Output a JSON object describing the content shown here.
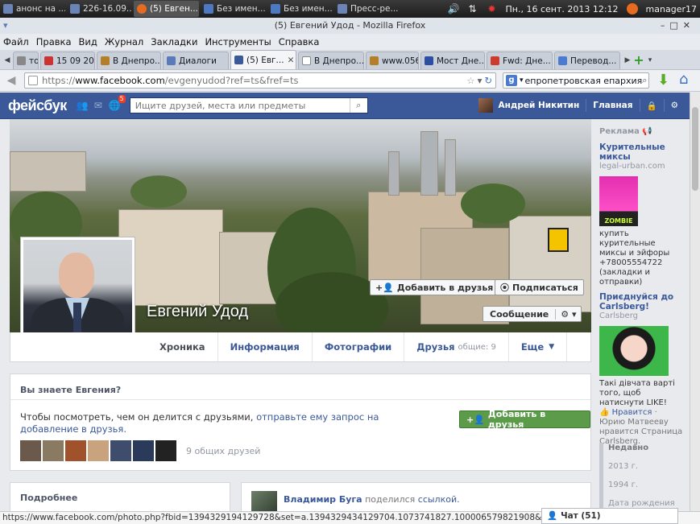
{
  "taskbar": {
    "tasks": [
      {
        "label": "анонс на ...",
        "color": "#6b84b8"
      },
      {
        "label": "226-16.09...",
        "color": "#6b84b8"
      },
      {
        "label": "(5) Евген...",
        "color": "#e66a1f"
      },
      {
        "label": "Без имен...",
        "color": "#4d78c2"
      },
      {
        "label": "Без имен...",
        "color": "#4d78c2"
      },
      {
        "label": "Пресс-ре...",
        "color": "#6b84b8"
      }
    ],
    "datetime": "Пн., 16 сент. 2013 12:12",
    "user": "manager17"
  },
  "window": {
    "title": "(5) Евгений Удод - Mozilla Firefox"
  },
  "menu": [
    "Файл",
    "Правка",
    "Вид",
    "Журнал",
    "Закладки",
    "Инструменты",
    "Справка"
  ],
  "tabs": [
    {
      "label": "то...",
      "color": "#888"
    },
    {
      "label": "15 09 201...",
      "color": "#c33"
    },
    {
      "label": "В Днепро...",
      "color": "#b57f2a"
    },
    {
      "label": "Диалоги",
      "color": "#5a7ab9"
    },
    {
      "label": "(5) Евг...",
      "color": "#3b5998",
      "active": true
    },
    {
      "label": "В Днепро...",
      "color": "#fff"
    },
    {
      "label": "www.056....",
      "color": "#b57f2a"
    },
    {
      "label": "Мост Дне...",
      "color": "#2c4ea3"
    },
    {
      "label": "Fwd: Дне...",
      "color": "#cc3b2e"
    },
    {
      "label": "Перевод...",
      "color": "#4a7bd0"
    }
  ],
  "address": {
    "scheme": "https://",
    "host": "www.facebook.com",
    "path": "/evgenyudod?ref=ts&fref=ts"
  },
  "search": {
    "value": "епропетровская епархия"
  },
  "fb": {
    "logo": "фейсбук",
    "notif_count": "5",
    "search_placeholder": "Ищите друзей, места или предметы",
    "user_name": "Андрей Никитин",
    "home": "Главная"
  },
  "profile": {
    "name": "Евгений Удод",
    "add_friend": "Добавить в друзья",
    "subscribe": "Подписаться",
    "message": "Сообщение",
    "tabs": {
      "timeline": "Хроника",
      "about": "Информация",
      "photos": "Фотографии",
      "friends": "Друзья",
      "friends_sub": "общие: 9",
      "more": "Еще"
    }
  },
  "know": {
    "title": "Вы знаете Евгения?",
    "text": "Чтобы посмотреть, чем он делится с друзьями,",
    "link": "отправьте ему запрос на добавление в друзья.",
    "button": "Добавить в друзья",
    "mutual": "9 общих друзей",
    "friend_colors": [
      "#6b5a4c",
      "#8a7a62",
      "#a0522d",
      "#c9a27e",
      "#3d4d6b",
      "#2a3a5a",
      "#222"
    ]
  },
  "more_panel": {
    "title": "Подробнее"
  },
  "post": {
    "author": "Владимир Буга",
    "verb": "поделился",
    "link": "ссылкой."
  },
  "ads": {
    "header": "Реклама",
    "ad1": {
      "title": "Курительные миксы",
      "domain": "legal-urban.com",
      "img_label": "ZOMBIE",
      "text": "купить курительные миксы и эйфоры +78005554722 (закладки и отправки)"
    },
    "ad2": {
      "title": "Приєднуйся до Carlsberg!",
      "sub": "Carlsberg",
      "text": "Такі дівчата варті того, щоб натиснути LIKE!",
      "like": "Нравится",
      "like_rest": "· Юрию Матвееву нравится Страница Carlsberg."
    }
  },
  "timeline_years": {
    "head": "Недавно",
    "items": [
      "2013 г.",
      "1994 г.",
      "Дата рождения"
    ]
  },
  "status": {
    "url": "https://www.facebook.com/photo.php?fbid=1394329194129728&set=a.1394329434129704.1073741827.100006579821908&type=1"
  },
  "chat": {
    "label": "Чат (51)"
  }
}
